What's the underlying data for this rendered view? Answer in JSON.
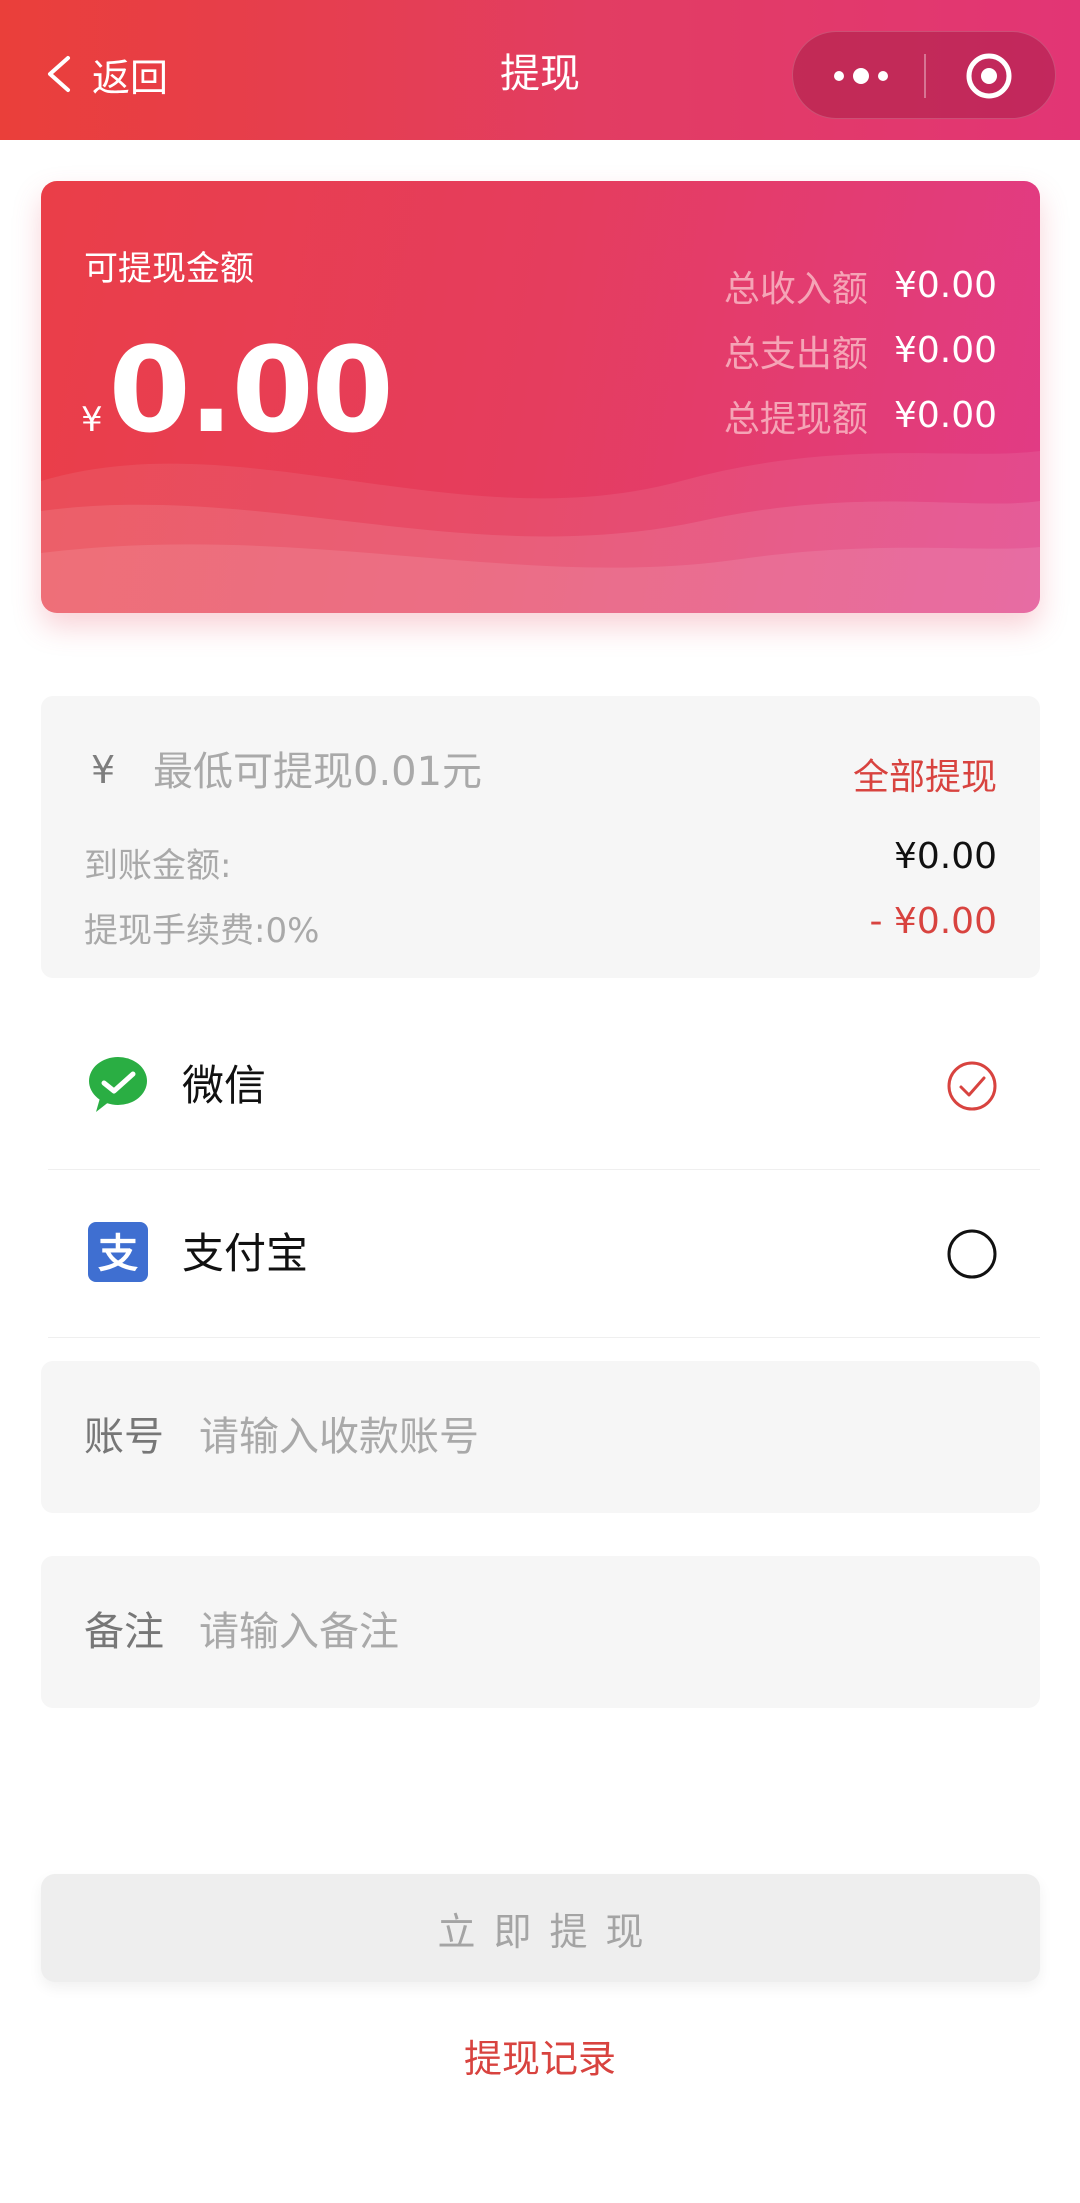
{
  "header": {
    "back_label": "返回",
    "title": "提现"
  },
  "balance": {
    "available_label": "可提现金额",
    "currency_symbol": "¥",
    "available_amount": "0.00",
    "stats": [
      {
        "label": "总收入额",
        "value": "¥0.00"
      },
      {
        "label": "总支出额",
        "value": "¥0.00"
      },
      {
        "label": "总提现额",
        "value": "¥0.00"
      }
    ]
  },
  "withdraw": {
    "currency_symbol": "¥",
    "amount_placeholder": "最低可提现0.01元",
    "withdraw_all_label": "全部提现",
    "arrival_label": "到账金额:",
    "arrival_value": "¥0.00",
    "fee_label": "提现手续费:0%",
    "fee_value": "- ¥0.00"
  },
  "payment_methods": [
    {
      "label": "微信",
      "icon": "wechat-icon",
      "selected": true
    },
    {
      "label": "支付宝",
      "icon": "alipay-icon",
      "selected": false
    }
  ],
  "fields": {
    "account_label": "账号",
    "account_placeholder": "请输入收款账号",
    "remark_label": "备注",
    "remark_placeholder": "请输入备注"
  },
  "actions": {
    "submit_label": "立即提现",
    "record_link": "提现记录"
  },
  "colors": {
    "accent": "#d8433f",
    "header_start": "#ea3f3a",
    "header_end": "#e23575",
    "wechat_green": "#2aae43",
    "alipay_blue": "#3f6fd1"
  }
}
